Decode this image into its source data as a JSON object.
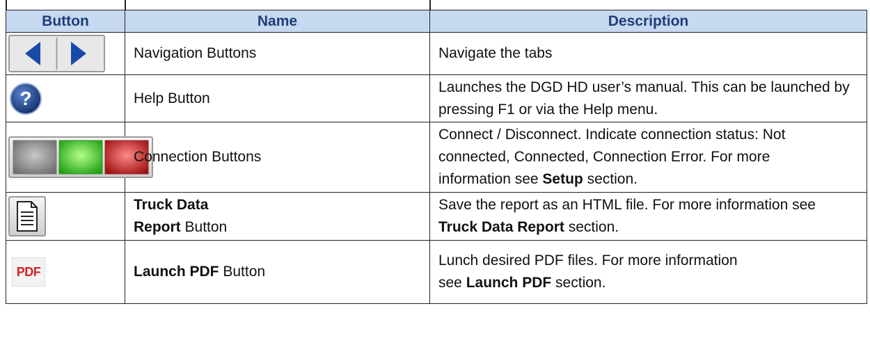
{
  "table": {
    "headers": {
      "button": "Button",
      "name": "Name",
      "description": "Description"
    },
    "rows": [
      {
        "icon": "navigation-arrows-icon",
        "name": "Navigation Buttons",
        "description": "Navigate the tabs"
      },
      {
        "icon": "help-icon",
        "name": "Help Button",
        "description": "Launches the DGD HD user’s manual. This can be launched by pressing F1 or via the Help menu."
      },
      {
        "icon": "connection-status-icons",
        "name": "Connection Buttons",
        "description_lines": [
          "Connect / Disconnect. Indicate connection status: Not",
          "connected, Connected, Connection Error. For more",
          "information see ",
          "Setup",
          " section."
        ],
        "status_colors": {
          "not_connected": "#9e9e9e",
          "connected": "#38d11c",
          "error": "#d52424"
        }
      },
      {
        "icon": "document-icon",
        "name_bold": "Truck Data",
        "name_line2_bold": "Report",
        "name_line2_rest": " Button",
        "description_start": "Save the report as an HTML file. For more information see ",
        "description_bold": "Truck Data Report",
        "description_end": " section."
      },
      {
        "icon": "pdf-icon",
        "icon_text": "PDF",
        "name_bold": "Launch PDF",
        "name_rest": " Button",
        "description_line1": "Lunch desired PDF files. For more information",
        "description_start": "see ",
        "description_bold": "Launch PDF",
        "description_end": " section."
      }
    ]
  },
  "colors": {
    "header_bg": "#c6d9f1",
    "header_text": "#1f3e78",
    "nav_arrow": "#1a4aa8",
    "help_circle": "#1f3f86"
  }
}
